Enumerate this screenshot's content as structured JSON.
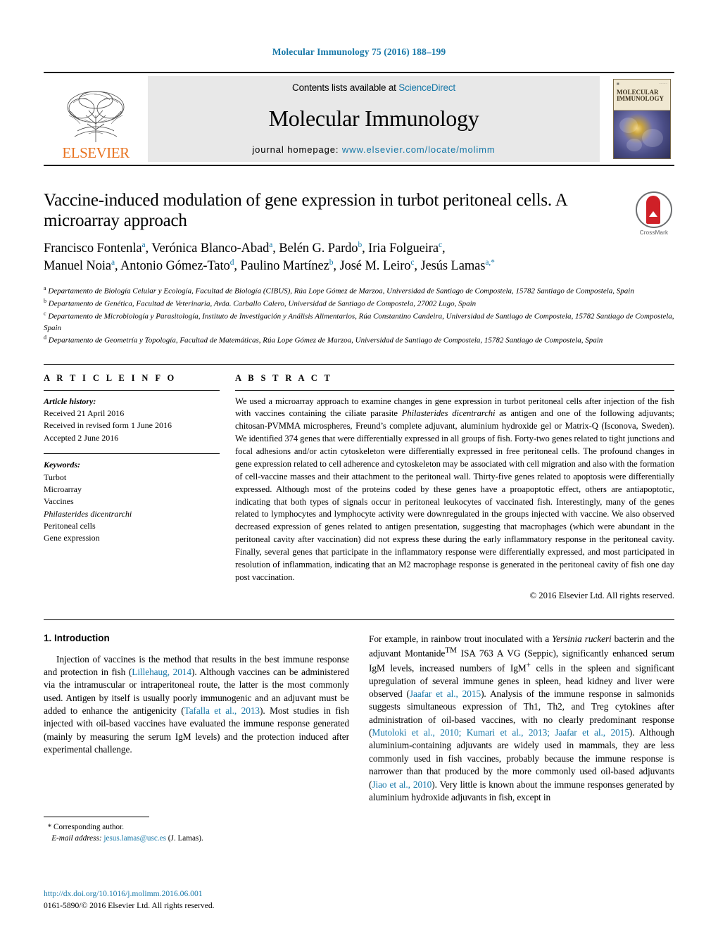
{
  "running_head": "Molecular Immunology 75 (2016) 188–199",
  "masthead": {
    "publisher_name": "ELSEVIER",
    "contents_prefix": "Contents lists available at ",
    "contents_link": "ScienceDirect",
    "journal_name": "Molecular Immunology",
    "homepage_prefix": "journal homepage: ",
    "homepage_url": "www.elsevier.com/locate/molimm",
    "cover": {
      "line1": "MOLECULAR",
      "line2": "IMMUNOLOGY"
    }
  },
  "article": {
    "title": "Vaccine-induced modulation of gene expression in turbot peritoneal cells. A microarray approach",
    "authors_line1": "Francisco Fontenla",
    "authors": "Francisco Fontenla a , Verónica Blanco-Abad a , Belén G. Pardo b , Iria Folgueira c , Manuel Noia a , Antonio Gómez-Tato d , Paulino Martínez b , José M. Leiro c , Jesús Lamas a,*",
    "crossmark_label": "CrossMark",
    "affiliations": [
      {
        "marker": "a",
        "text": "Departamento de Biología Celular y Ecología, Facultad de Biología (CIBUS), Rúa Lope Gómez de Marzoa, Universidad de Santiago de Compostela, 15782 Santiago de Compostela, Spain"
      },
      {
        "marker": "b",
        "text": "Departamento de Genética, Facultad de Veterinaria, Avda. Carballo Calero, Universidad de Santiago de Compostela, 27002 Lugo, Spain"
      },
      {
        "marker": "c",
        "text": "Departamento de Microbiología y Parasitología, Instituto de Investigación y Análisis Alimentarios, Rúa Constantino Candeira, Universidad de Santiago de Compostela, 15782 Santiago de Compostela, Spain"
      },
      {
        "marker": "d",
        "text": "Departamento de Geometría y Topología, Facultad de Matemáticas, Rúa Lope Gómez de Marzoa, Universidad de Santiago de Compostela, 15782 Santiago de Compostela, Spain"
      }
    ]
  },
  "article_info": {
    "heading": "A R T I C L E   I N F O",
    "history_label": "Article history:",
    "history": [
      "Received 21 April 2016",
      "Received in revised form 1 June 2016",
      "Accepted 2 June 2016"
    ],
    "keywords_label": "Keywords:",
    "keywords": [
      "Turbot",
      "Microarray",
      "Vaccines",
      "Philasterides dicentrarchi",
      "Peritoneal cells",
      "Gene expression"
    ],
    "keyword_italic_index": 3
  },
  "abstract": {
    "heading": "A B S T R A C T",
    "text_part_1": "We used a microarray approach to examine changes in gene expression in turbot peritoneal cells after injection of the fish with vaccines containing the ciliate parasite ",
    "species": "Philasterides dicentrarchi",
    "text_part_2": " as antigen and one of the following adjuvants; chitosan-PVMMA microspheres, Freund’s complete adjuvant, aluminium hydroxide gel or Matrix-Q (Isconova, Sweden). We identified 374 genes that were differentially expressed in all groups of fish. Forty-two genes related to tight junctions and focal adhesions and/or actin cytoskeleton were differentially expressed in free peritoneal cells. The profound changes in gene expression related to cell adherence and cytoskeleton may be associated with cell migration and also with the formation of cell-vaccine masses and their attachment to the peritoneal wall. Thirty-five genes related to apoptosis were differentially expressed. Although most of the proteins coded by these genes have a proapoptotic effect, others are antiapoptotic, indicating that both types of signals occur in peritoneal leukocytes of vaccinated fish. Interestingly, many of the genes related to lymphocytes and lymphocyte activity were downregulated in the groups injected with vaccine. We also observed decreased expression of genes related to antigen presentation, suggesting that macrophages (which were abundant in the peritoneal cavity after vaccination) did not express these during the early inflammatory response in the peritoneal cavity. Finally, several genes that participate in the inflammatory response were differentially expressed, and most participated in resolution of inflammation, indicating that an M2 macrophage response is generated in the peritoneal cavity of fish one day post vaccination.",
    "copyright": "© 2016 Elsevier Ltd. All rights reserved."
  },
  "introduction": {
    "heading": "1.  Introduction",
    "left_p1_a": "Injection of vaccines is the method that results in the best immune response and protection in fish (",
    "left_cite1": "Lillehaug, 2014",
    "left_p1_b": "). Although vaccines can be administered via the intramuscular or intraperitoneal route, the latter is the most commonly used. Antigen by itself is usually poorly immunogenic and an adjuvant must be added to enhance the antigenicity (",
    "left_cite2": "Tafalla et al., 2013",
    "left_p1_c": "). Most studies in fish injected with oil-based vaccines have evaluated the immune response generated (mainly by measuring the serum IgM levels) and the protection induced after experimental challenge.",
    "right_a": "For example, in rainbow trout inoculated with a ",
    "right_species": "Yersinia ruckeri",
    "right_b": " bacterin and the adjuvant Montanide",
    "right_tm": "TM",
    "right_c": " ISA 763 A VG (Seppic), significantly enhanced serum IgM levels, increased numbers of IgM",
    "right_sup_plus": "+",
    "right_d": " cells in the spleen and significant upregulation of several immune genes in spleen, head kidney and liver were observed (",
    "right_cite1": "Jaafar et al., 2015",
    "right_e": "). Analysis of the immune response in salmonids suggests simultaneous expression of Th1, Th2, and Treg cytokines after administration of oil-based vaccines, with no clearly predominant response (",
    "right_cite2": "Mutoloki et al., 2010; Kumari et al., 2013; Jaafar et al., 2015",
    "right_f": "). Although aluminium-containing adjuvants are widely used in mammals, they are less commonly used in fish vaccines, probably because the immune response is narrower than that produced by the more commonly used oil-based adjuvants (",
    "right_cite3": "Jiao et al., 2010",
    "right_g": "). Very little is known about the immune responses generated by aluminium hydroxide adjuvants in fish, except in"
  },
  "footer": {
    "corresponding_marker": "*",
    "corresponding_label": "Corresponding author.",
    "email_label": "E-mail address:",
    "email": "jesus.lamas@usc.es",
    "email_suffix": "(J. Lamas).",
    "doi": "http://dx.doi.org/10.1016/j.molimm.2016.06.001",
    "issn_line": "0161-5890/© 2016 Elsevier Ltd. All rights reserved."
  },
  "colors": {
    "link": "#1878a8",
    "elsevier_orange": "#e87422",
    "crossmark_red": "#cf2027"
  }
}
